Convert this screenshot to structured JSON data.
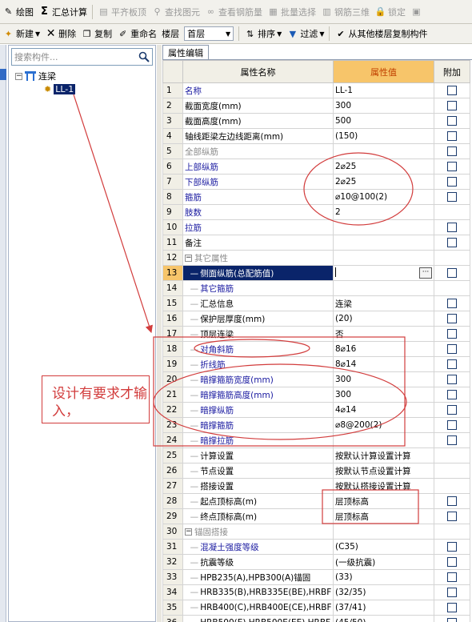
{
  "toolbar1": {
    "items": [
      {
        "label": "绘图",
        "icon": "draw-icon",
        "enabled": true
      },
      {
        "label": "汇总计算",
        "icon": "sigma-icon",
        "enabled": true
      },
      {
        "label": "平齐板顶",
        "icon": "align-slab-icon",
        "enabled": false
      },
      {
        "label": "查找图元",
        "icon": "find-icon",
        "enabled": false
      },
      {
        "label": "查看钢筋量",
        "icon": "view-rebar-icon",
        "enabled": false
      },
      {
        "label": "批量选择",
        "icon": "batch-select-icon",
        "enabled": false
      },
      {
        "label": "钢筋三维",
        "icon": "rebar-3d-icon",
        "enabled": false
      },
      {
        "label": "锁定",
        "icon": "lock-icon",
        "enabled": false
      }
    ]
  },
  "toolbar2": {
    "new_label": "新建",
    "delete_label": "删除",
    "copy_label": "复制",
    "rename_label": "重命名",
    "floor_label": "楼层",
    "floor_value": "首层",
    "sort_label": "排序",
    "filter_label": "过滤",
    "copy_from_floor_label": "从其他楼层复制构件"
  },
  "left_panel": {
    "search_placeholder": "搜索构件...",
    "tree": {
      "root_label": "连梁",
      "expander": "−",
      "children": [
        {
          "label": "LL-1",
          "selected": true
        }
      ]
    }
  },
  "grid": {
    "tab_label": "属性编辑",
    "headers": {
      "name": "属性名称",
      "value": "属性值",
      "extra": "附加"
    },
    "rows": [
      {
        "n": "1",
        "name": "名称",
        "value": "LL-1",
        "style": "blue",
        "check": true
      },
      {
        "n": "2",
        "name": "截面宽度(mm)",
        "value": "300",
        "style": "normal",
        "check": true
      },
      {
        "n": "3",
        "name": "截面高度(mm)",
        "value": "500",
        "style": "normal",
        "check": true
      },
      {
        "n": "4",
        "name": "轴线距梁左边线距离(mm)",
        "value": "(150)",
        "style": "normal",
        "check": true
      },
      {
        "n": "5",
        "name": "全部纵筋",
        "value": "",
        "style": "gray",
        "check": true
      },
      {
        "n": "6",
        "name": "上部纵筋",
        "value": "2⌀25",
        "style": "blue",
        "check": true
      },
      {
        "n": "7",
        "name": "下部纵筋",
        "value": "2⌀25",
        "style": "blue",
        "check": true
      },
      {
        "n": "8",
        "name": "箍筋",
        "value": "⌀10@100(2)",
        "style": "blue",
        "check": true
      },
      {
        "n": "9",
        "name": "肢数",
        "value": "2",
        "style": "blue",
        "check": false
      },
      {
        "n": "10",
        "name": "拉筋",
        "value": "",
        "style": "blue",
        "check": true
      },
      {
        "n": "11",
        "name": "备注",
        "value": "",
        "style": "normal",
        "check": true
      },
      {
        "n": "12",
        "name": "其它属性",
        "value": "",
        "style": "group",
        "check": false
      },
      {
        "n": "13",
        "name": "侧面纵筋(总配筋值)",
        "value": "",
        "style": "child-hl",
        "check": true,
        "active": true
      },
      {
        "n": "14",
        "name": "其它箍筋",
        "value": "",
        "style": "child-blue",
        "check": false
      },
      {
        "n": "15",
        "name": "汇总信息",
        "value": "连梁",
        "style": "child",
        "check": true
      },
      {
        "n": "16",
        "name": "保护层厚度(mm)",
        "value": "(20)",
        "style": "child",
        "check": true
      },
      {
        "n": "17",
        "name": "顶层连梁",
        "value": "否",
        "style": "child",
        "check": true
      },
      {
        "n": "18",
        "name": "对角斜筋",
        "value": "8⌀16",
        "style": "child-blue",
        "check": true
      },
      {
        "n": "19",
        "name": "折线筋",
        "value": "8⌀14",
        "style": "child-blue",
        "check": true
      },
      {
        "n": "20",
        "name": "暗撑箍筋宽度(mm)",
        "value": "300",
        "style": "child-blue",
        "check": true
      },
      {
        "n": "21",
        "name": "暗撑箍筋高度(mm)",
        "value": "300",
        "style": "child-blue",
        "check": true
      },
      {
        "n": "22",
        "name": "暗撑纵筋",
        "value": "4⌀14",
        "style": "child-blue",
        "check": true
      },
      {
        "n": "23",
        "name": "暗撑箍筋",
        "value": "⌀8@200(2)",
        "style": "child-blue",
        "check": true
      },
      {
        "n": "24",
        "name": "暗撑拉筋",
        "value": "",
        "style": "child-blue",
        "check": true
      },
      {
        "n": "25",
        "name": "计算设置",
        "value": "按默认计算设置计算",
        "style": "child",
        "check": false
      },
      {
        "n": "26",
        "name": "节点设置",
        "value": "按默认节点设置计算",
        "style": "child",
        "check": false
      },
      {
        "n": "27",
        "name": "搭接设置",
        "value": "按默认搭接设置计算",
        "style": "child",
        "check": false
      },
      {
        "n": "28",
        "name": "起点顶标高(m)",
        "value": "层顶标高",
        "style": "child",
        "check": true
      },
      {
        "n": "29",
        "name": "终点顶标高(m)",
        "value": "层顶标高",
        "style": "child",
        "check": true
      },
      {
        "n": "30",
        "name": "锚固搭接",
        "value": "",
        "style": "group",
        "check": false
      },
      {
        "n": "31",
        "name": "混凝土强度等级",
        "value": "(C35)",
        "style": "child-blue",
        "check": true
      },
      {
        "n": "32",
        "name": "抗震等级",
        "value": "(一级抗震)",
        "style": "child",
        "check": true
      },
      {
        "n": "33",
        "name": "HPB235(A),HPB300(A)锚固",
        "value": "(33)",
        "style": "child",
        "check": true
      },
      {
        "n": "34",
        "name": "HRB335(B),HRB335E(BE),HRBF",
        "value": "(32/35)",
        "style": "child",
        "check": true
      },
      {
        "n": "35",
        "name": "HRB400(C),HRB400E(CE),HRBF",
        "value": "(37/41)",
        "style": "child",
        "check": true
      },
      {
        "n": "36",
        "name": "HRB500(E),HRB500E(EE),HRBF",
        "value": "(45/50)",
        "style": "child",
        "check": true
      }
    ]
  },
  "annotation": {
    "note": "设计有要求才输入，",
    "color": "#d23c3c"
  },
  "colors": {
    "header_value_bg": "#f7c56a",
    "selection": "#0a246a",
    "blue_text": "#1a1aa0"
  }
}
